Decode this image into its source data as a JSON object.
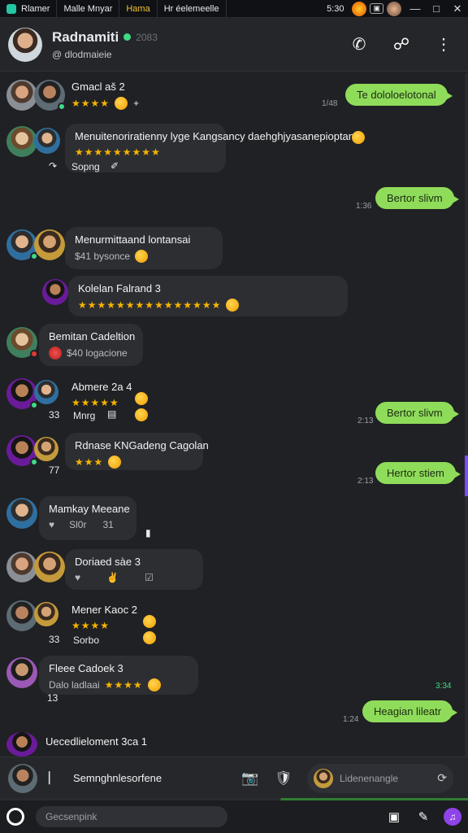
{
  "system_bar": {
    "app_name": "Rlamer",
    "tab2": "Malle Mnyar",
    "tab3": "Hama",
    "tab4": "Hr éelemeelle",
    "time": "5:30",
    "accent": "#24c6a3"
  },
  "header": {
    "name": "Radnamiti",
    "extra": "2083",
    "subtitle": "@ dlodmaieie",
    "call_icon": "phone-icon",
    "video_icon": "share-icon",
    "menu_icon": "more-vertical-icon"
  },
  "messages": [
    {
      "name": "Gmacl aš 2",
      "stars": "★★★★",
      "line2": "✦"
    },
    {
      "name": "Menuitenoriratienny lyge Kangsancy daehghjyasanepioptana",
      "stars": "★★★★★★★★★",
      "meta1": "Sopng",
      "meta2": "✐"
    },
    {
      "name": "Menurmittaand lontansai",
      "line2": "$41 bysonce"
    },
    {
      "name": "Kolelan Falrand 3",
      "stars": "★★★★★★★★★★★★★★★"
    },
    {
      "name": "Bemitan Cadeltion",
      "line2": "$40 logacione"
    },
    {
      "name": "Abmere 2a 4",
      "stars": "★★★★★",
      "meta1": "33",
      "meta2": "Mnrg"
    },
    {
      "name": "Rdnase KNGadeng Cagolan",
      "stars": "★★★",
      "meta1": "77"
    },
    {
      "name": "Mamkay Meeane",
      "meta1": "Sl0r",
      "meta2": "31"
    },
    {
      "name": "Doriaed sàe 3"
    },
    {
      "name": "Mener Kaoc 2",
      "stars": "★★★★",
      "meta1": "33",
      "meta2": "Sorbo"
    },
    {
      "name": "Fleee Cadoek 3",
      "stars": "★★★★",
      "line2": "Dalo ladlaai",
      "meta1": "13"
    },
    {
      "name": "Uecedlieloment 3ca 1"
    }
  ],
  "outgoing": [
    {
      "text": "Te dololoelotonal",
      "time": "1/48"
    },
    {
      "text": "Bertor slivm",
      "time": "1:36"
    },
    {
      "text": "Bertor slivm",
      "time": "2:13"
    },
    {
      "text": "Hertor stiem",
      "time": "2:13"
    },
    {
      "text": "Heagian lileatr",
      "time": "1:24"
    }
  ],
  "side_time": "3:34",
  "compose": {
    "placeholder_text": "Semnghnlesorfene",
    "search_text": "Lidenenangle",
    "icons": [
      "camera-icon",
      "shield-icon",
      "refresh-icon"
    ]
  },
  "bottom": {
    "search_placeholder": "Gecsenpink",
    "icons": [
      "record-icon",
      "screen-icon",
      "pen-icon",
      "mic-icon"
    ]
  }
}
